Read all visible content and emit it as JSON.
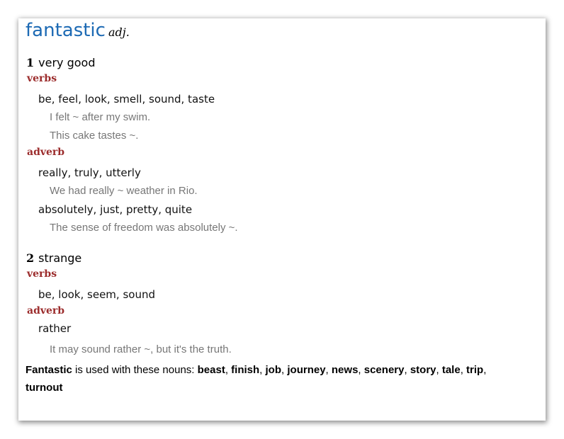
{
  "entry": {
    "headword": "fantastic",
    "pos": "adj."
  },
  "senses": [
    {
      "number": "1",
      "meaning": "very good",
      "groups": [
        {
          "category": "verbs",
          "collocations": [
            {
              "words": "be, feel, look, smell, sound, taste",
              "examples": [
                "I felt ~ after my swim.",
                "This cake tastes ~."
              ]
            }
          ]
        },
        {
          "category": "adverb",
          "collocations": [
            {
              "words": "really, truly, utterly",
              "examples": [
                "We had really ~ weather in Rio."
              ]
            },
            {
              "words": "absolutely, just, pretty, quite",
              "examples": [
                "The sense of freedom was absolutely ~."
              ]
            }
          ]
        }
      ]
    },
    {
      "number": "2",
      "meaning": "strange",
      "groups": [
        {
          "category": "verbs",
          "collocations": [
            {
              "words": "be, look, seem, sound",
              "examples": []
            }
          ]
        },
        {
          "category": "adverb",
          "collocations": [
            {
              "words": "rather",
              "examples": [
                "It may sound rather ~, but it's the truth."
              ]
            }
          ]
        }
      ]
    }
  ],
  "noun_note": {
    "subject": "Fantastic",
    "text": " is used with these nouns: ",
    "nouns": [
      "beast",
      "finish",
      "job",
      "journey",
      "news",
      "scenery",
      "story",
      "tale",
      "trip",
      "turnout"
    ]
  }
}
